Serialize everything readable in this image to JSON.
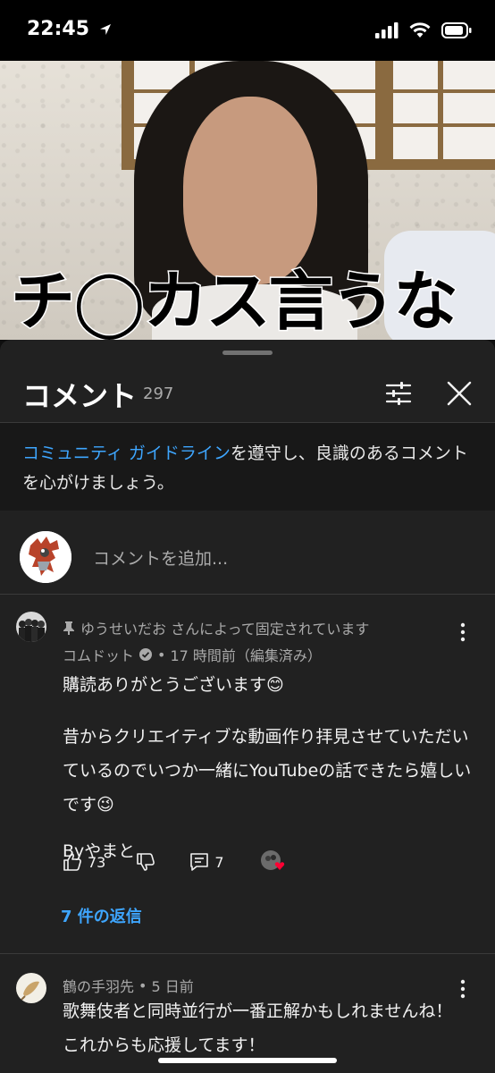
{
  "status": {
    "time": "22:45"
  },
  "video": {
    "caption": "チ◯カス言うな",
    "progress": 0.05
  },
  "comments_panel": {
    "title": "コメント",
    "count": "297",
    "guideline": {
      "link": "コミュニティ ガイドライン",
      "text": "を遵守し、良識のあるコメントを心がけましょう。"
    },
    "add_placeholder": "コメントを追加...",
    "comments": [
      {
        "pinned_text": "ゆうせいだお さんによって固定されています",
        "author": "コムドット",
        "verified": true,
        "time": "17 時間前（編集済み）",
        "lines": [
          "購読ありがとうございます😊",
          "昔からクリエイティブな動画作り拝見させていただいているのでいつか一緒にYouTubeの話できたら嬉しいです😉",
          "Byやまと"
        ],
        "likes": "73",
        "reply_count": "7",
        "replies_link": "7 件の返信"
      },
      {
        "author": "鶴の手羽先",
        "time": "5 日前",
        "lines": [
          "歌舞伎者と同時並行が一番正解かもしれませんね！",
          "これからも応援してます！"
        ]
      }
    ]
  },
  "colors": {
    "background": "#0f0f0f",
    "sheet": "#212121",
    "link": "#3ea6ff",
    "progress": "#ff0000",
    "heart": "#ff0033"
  }
}
